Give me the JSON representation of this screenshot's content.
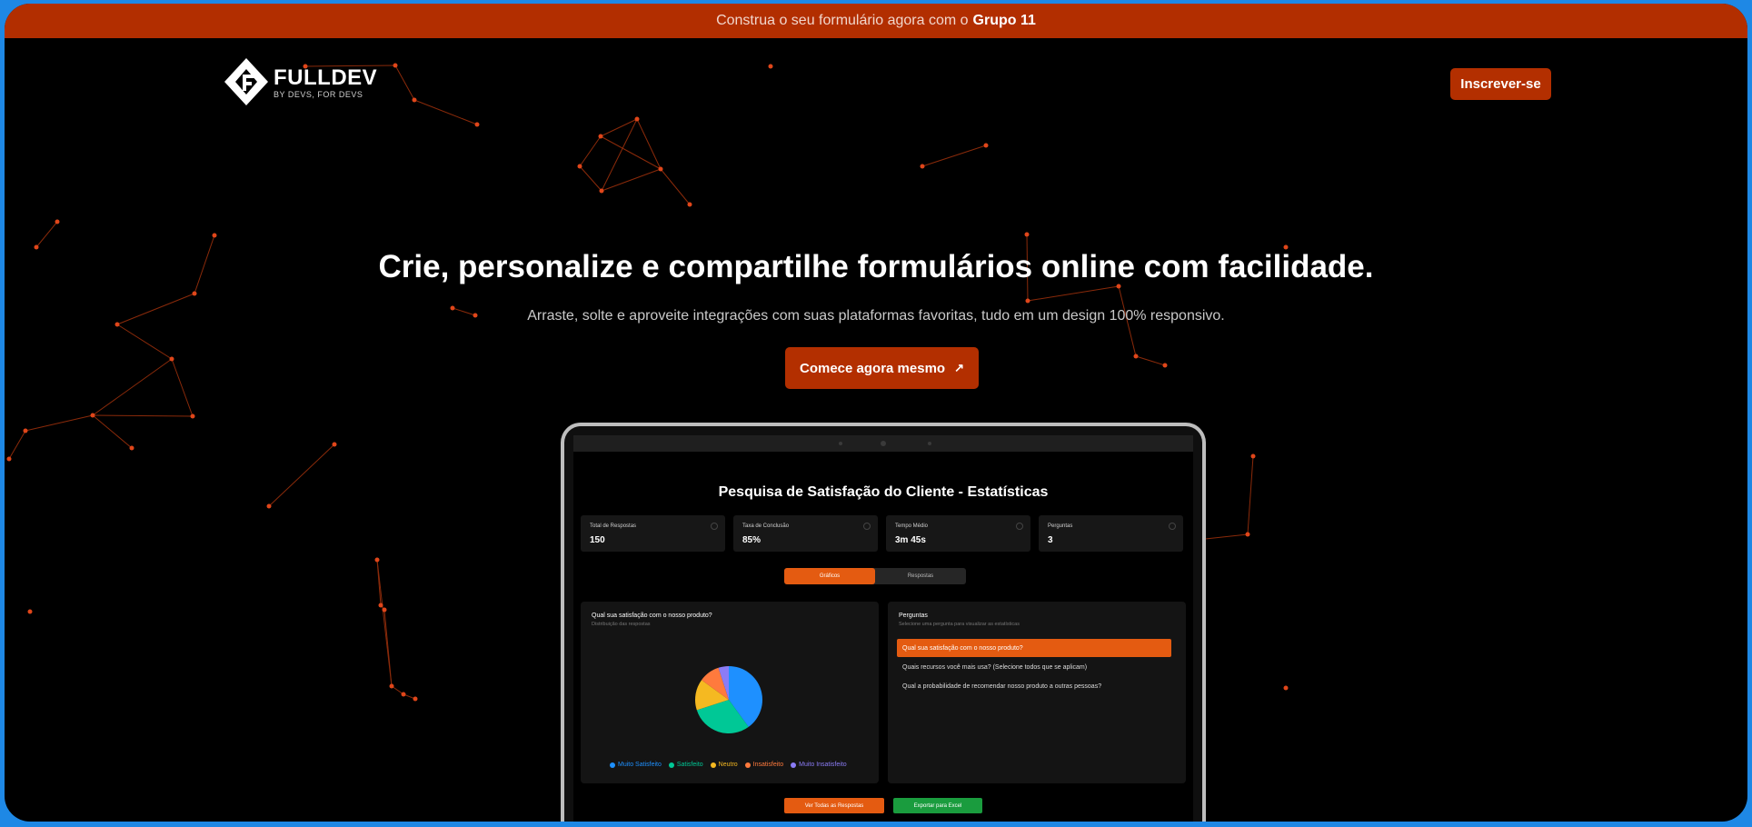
{
  "announcement": {
    "text": "Construa o seu formulário agora com o",
    "highlight": "Grupo 11",
    "bg_color": "#b22e00"
  },
  "header": {
    "logo": {
      "name": "FULLDEV",
      "tagline": "BY DEVS, FOR DEVS"
    },
    "signup_label": "Inscrever-se"
  },
  "hero": {
    "title": "Crie, personalize e compartilhe formulários online com facilidade.",
    "subtitle": "Arraste, solte e aproveite integrações com suas plataformas favoritas, tudo em um design 100% responsivo.",
    "cta_label": "Comece agora mesmo",
    "cta_icon": "arrow-up-right-icon",
    "accent_color": "#b32f00"
  },
  "dashboard": {
    "title": "Pesquisa de Satisfação do Cliente - Estatísticas",
    "stats": [
      {
        "label": "Total de Respostas",
        "value": "150"
      },
      {
        "label": "Taxa de Conclusão",
        "value": "85%"
      },
      {
        "label": "Tempo Médio",
        "value": "3m 45s"
      },
      {
        "label": "Perguntas",
        "value": "3"
      }
    ],
    "tabs": [
      {
        "label": "Gráficos",
        "active": true
      },
      {
        "label": "Respostas",
        "active": false
      }
    ],
    "chart_panel": {
      "title": "Qual sua satisfação com o nosso produto?",
      "subtitle": "Distribuição das respostas"
    },
    "questions_panel": {
      "title": "Perguntas",
      "subtitle": "Selecione uma pergunta para visualizar as estatísticas",
      "items": [
        {
          "label": "Qual sua satisfação com o nosso produto?",
          "active": true
        },
        {
          "label": "Quais recursos você mais usa? (Selecione todos que se aplicam)",
          "active": false
        },
        {
          "label": "Qual a probabilidade de recomendar nosso produto a outras pessoas?",
          "active": false
        }
      ]
    },
    "buttons": {
      "view_all": "Ver Todas as Respostas",
      "export": "Exportar para Excel"
    }
  },
  "chart_data": {
    "type": "pie",
    "categories": [
      "Muito Satisfeito",
      "Satisfeito",
      "Neutro",
      "Insatisfeito",
      "Muito Insatisfeito"
    ],
    "values": [
      40,
      30,
      15,
      10,
      5
    ],
    "colors": [
      "#1e90ff",
      "#00c896",
      "#f5b921",
      "#ff7a3d",
      "#8b7cf6"
    ],
    "legend_position": "bottom"
  }
}
